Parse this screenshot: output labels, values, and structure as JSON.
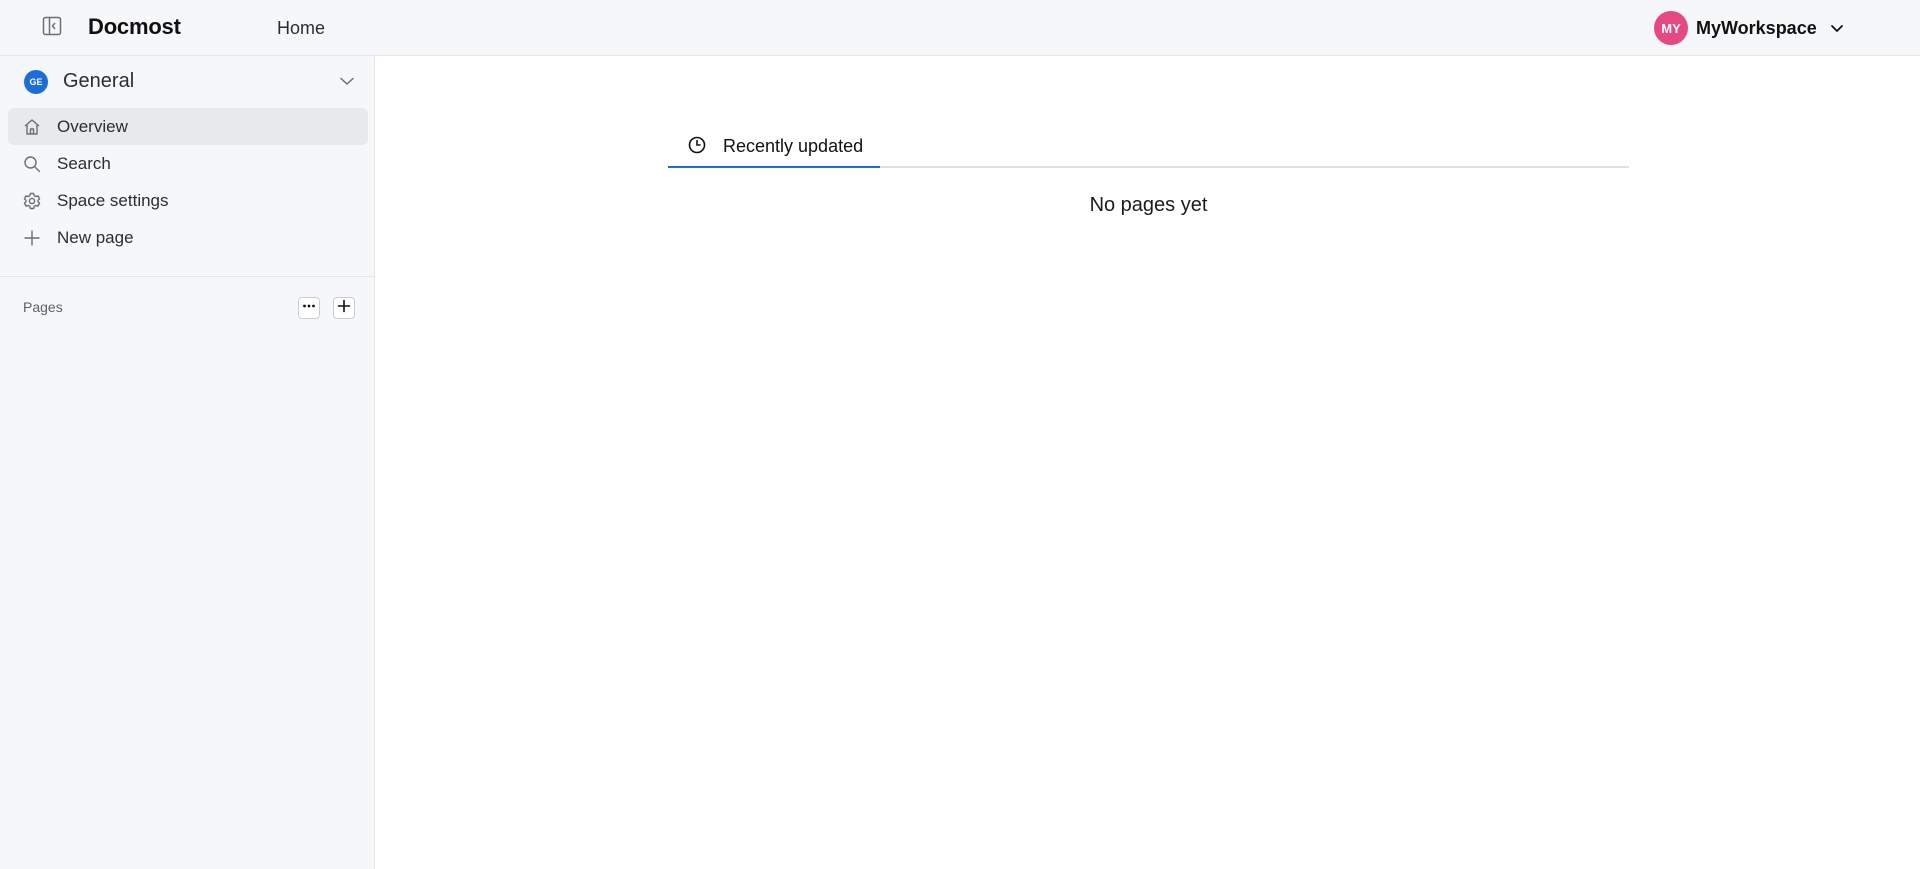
{
  "header": {
    "brand": "Docmost",
    "nav_home": "Home",
    "workspace": {
      "initials": "MY",
      "name": "MyWorkspace",
      "avatar_color": "#e64980"
    }
  },
  "sidebar": {
    "space": {
      "initials": "GE",
      "name": "General",
      "avatar_color": "#1c6ddc"
    },
    "menu": [
      {
        "label": "Overview",
        "icon": "home-icon",
        "active": true
      },
      {
        "label": "Search",
        "icon": "search-icon",
        "active": false
      },
      {
        "label": "Space settings",
        "icon": "gear-icon",
        "active": false
      },
      {
        "label": "New page",
        "icon": "plus-icon",
        "active": false
      }
    ],
    "pages_label": "Pages"
  },
  "main": {
    "tab_label": "Recently updated",
    "tab_icon": "clock-icon",
    "empty_text": "No pages yet",
    "accent_color": "#1c6ddc"
  }
}
